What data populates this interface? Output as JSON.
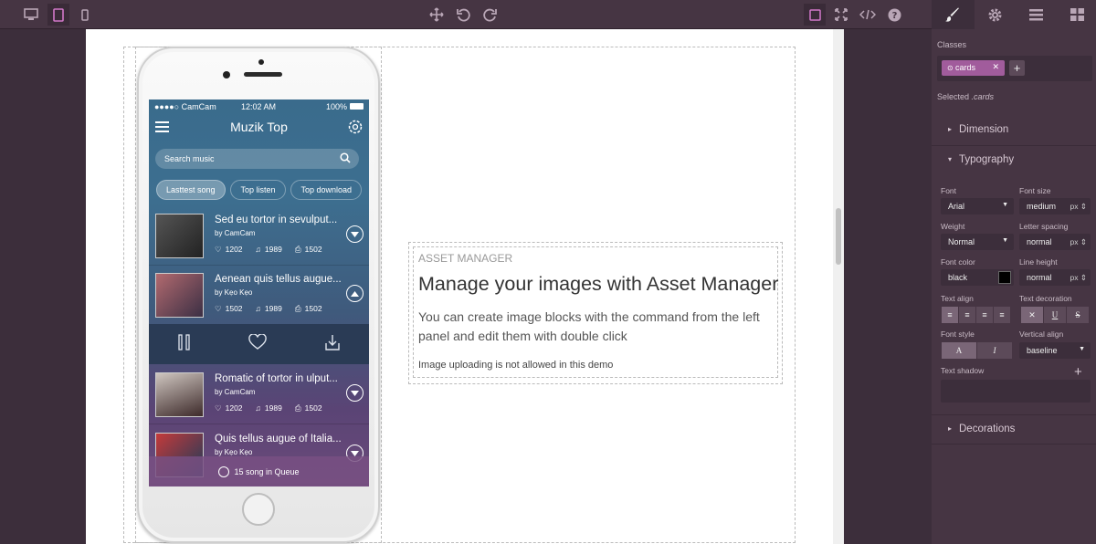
{
  "topbar": {
    "devices": [
      "desktop-icon",
      "tablet-icon",
      "mobile-icon"
    ],
    "tools": [
      "move-icon",
      "undo-icon",
      "redo-icon"
    ],
    "options": [
      "outline-icon",
      "fullscreen-icon",
      "code-icon",
      "help-icon"
    ],
    "panel_tabs": [
      "brush-icon",
      "gear-icon",
      "layers-icon",
      "blocks-icon"
    ]
  },
  "phone": {
    "status": {
      "carrier": "●●●●○ CamCam",
      "time": "12:02 AM",
      "battery": "100%"
    },
    "app_title": "Muzik Top",
    "search_placeholder": "Search music",
    "tabs": [
      "Lasttest song",
      "Top listen",
      "Top download"
    ],
    "songs": [
      {
        "title": "Sed eu tortor in sevulput...",
        "by": "by CamCam",
        "likes": "1202",
        "plays": "1989",
        "downloads": "1502"
      },
      {
        "title": "Aenean quis tellus augue...",
        "by": "by Kẹo Kẹo",
        "likes": "1502",
        "plays": "1989",
        "downloads": "1502"
      },
      {
        "title": "Romatic of tortor in ulput...",
        "by": "by CamCam",
        "likes": "1202",
        "plays": "1989",
        "downloads": "1502"
      },
      {
        "title": "Quis tellus augue of Italia...",
        "by": "by Kẹo Kẹo"
      }
    ],
    "queue": "15 song in Queue"
  },
  "asset": {
    "label": "ASSET MANAGER",
    "title": "Manage your images with Asset Manager",
    "text": "You can create image blocks with the command from the left panel and edit them with double click",
    "note": "Image uploading is not allowed in this demo"
  },
  "panel": {
    "classes_label": "Classes",
    "class_tag": "cards",
    "selected_label": "Selected",
    "selected_value": ".cards",
    "sectors": {
      "dimension": "Dimension",
      "typography": "Typography",
      "decorations": "Decorations"
    },
    "props": {
      "font": {
        "label": "Font",
        "value": "Arial"
      },
      "font_size": {
        "label": "Font size",
        "value": "medium",
        "unit": "px"
      },
      "weight": {
        "label": "Weight",
        "value": "Normal"
      },
      "letter_spacing": {
        "label": "Letter spacing",
        "value": "normal",
        "unit": "px"
      },
      "font_color": {
        "label": "Font color",
        "value": "black"
      },
      "line_height": {
        "label": "Line height",
        "value": "normal",
        "unit": "px"
      },
      "text_align": {
        "label": "Text align"
      },
      "text_decoration": {
        "label": "Text decoration",
        "options": [
          "✕",
          "U",
          "S"
        ]
      },
      "font_style": {
        "label": "Font style",
        "options": [
          "A",
          "I"
        ]
      },
      "vertical_align": {
        "label": "Vertical align",
        "value": "baseline"
      },
      "text_shadow": {
        "label": "Text shadow"
      }
    }
  },
  "colors": {
    "accent": "#d278c9",
    "panel_bg": "#463543",
    "tag": "#a15c9c"
  }
}
